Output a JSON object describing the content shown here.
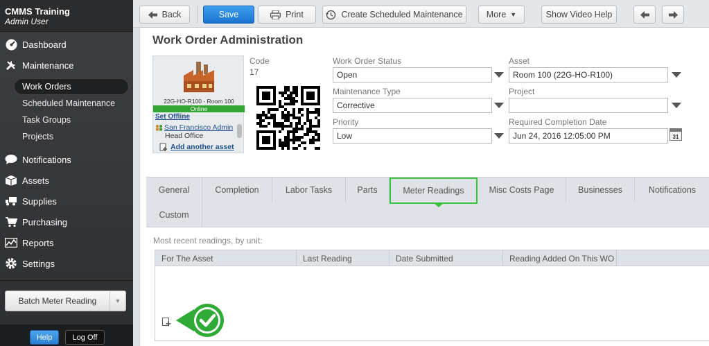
{
  "sidebar": {
    "app_name": "CMMS Training",
    "user_name": "Admin User",
    "nav": [
      {
        "label": "Dashboard",
        "icon": "dashboard-icon"
      },
      {
        "label": "Maintenance",
        "icon": "tools-icon"
      },
      {
        "label": "Notifications",
        "icon": "speech-bubble-icon"
      },
      {
        "label": "Assets",
        "icon": "boxes-icon"
      },
      {
        "label": "Supplies",
        "icon": "truck-icon"
      },
      {
        "label": "Purchasing",
        "icon": "cart-icon"
      },
      {
        "label": "Reports",
        "icon": "chart-icon"
      },
      {
        "label": "Settings",
        "icon": "gear-icon"
      }
    ],
    "maintenance_sub": [
      "Work Orders",
      "Scheduled Maintenance",
      "Task Groups",
      "Projects"
    ],
    "active_sub": "Work Orders",
    "batch_button": "Batch Meter Reading",
    "help_button": "Help",
    "logoff_button": "Log Off"
  },
  "toolbar": {
    "back": "Back",
    "save": "Save",
    "print": "Print",
    "create_scheduled": "Create Scheduled Maintenance",
    "more": "More",
    "show_video_help": "Show Video Help"
  },
  "page": {
    "title": "Work Order Administration"
  },
  "asset_card": {
    "code": "22G-HO-R100 - Room 100",
    "status": "Online",
    "set_offline": "Set Offline",
    "location": "San Francisco Admin",
    "location_sub": "Head Office",
    "add_asset": "Add another asset"
  },
  "form": {
    "code_label": "Code",
    "code_value": "17",
    "status_label": "Work Order Status",
    "status_value": "Open",
    "asset_label": "Asset",
    "asset_value": "Room 100 (22G-HO-R100)",
    "type_label": "Maintenance Type",
    "type_value": "Corrective",
    "project_label": "Project",
    "project_value": "",
    "priority_label": "Priority",
    "priority_value": "Low",
    "due_label": "Required Completion Date",
    "due_value": "Jun 24, 2016 12:05:00 PM",
    "calendar_day": "31"
  },
  "tabs": [
    "General",
    "Completion",
    "Labor Tasks",
    "Parts",
    "Meter Readings",
    "Misc Costs Page",
    "Businesses",
    "Notifications",
    "Custom"
  ],
  "active_tab": "Meter Readings",
  "meter": {
    "caption": "Most recent readings, by unit:",
    "columns": [
      "For The Asset",
      "Last Reading",
      "Date Submitted",
      "Reading Added On This WO"
    ]
  },
  "colors": {
    "accent_blue": "#1b74d0",
    "highlight_green": "#39c23c",
    "online_green": "#33a532"
  }
}
